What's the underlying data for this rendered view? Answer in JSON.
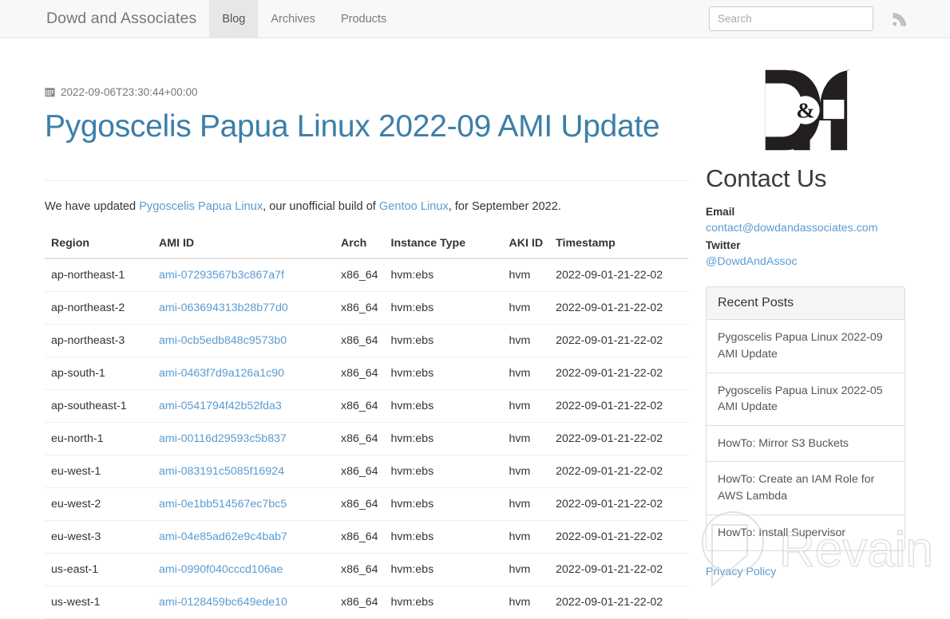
{
  "navbar": {
    "brand": "Dowd and Associates",
    "items": [
      {
        "label": "Blog",
        "active": true
      },
      {
        "label": "Archives",
        "active": false
      },
      {
        "label": "Products",
        "active": false
      }
    ],
    "search": {
      "placeholder": "Search",
      "value": ""
    },
    "rss_icon": "rss-icon"
  },
  "post": {
    "date_icon": "calendar-icon",
    "date": "2022-09-06T23:30:44+00:00",
    "title": "Pygoscelis Papua Linux 2022-09 AMI Update",
    "intro": {
      "part1": "We have updated ",
      "link1": "Pygoscelis Papua Linux",
      "part2": ", our unofficial build of ",
      "link2": "Gentoo Linux",
      "part3": ", for September 2022."
    }
  },
  "table": {
    "headers": [
      "Region",
      "AMI ID",
      "Arch",
      "Instance Type",
      "AKI ID",
      "Timestamp"
    ],
    "rows": [
      {
        "region": "ap-northeast-1",
        "ami_id": "ami-07293567b3c867a7f",
        "arch": "x86_64",
        "instance_type": "hvm:ebs",
        "aki_id": "hvm",
        "timestamp": "2022-09-01-21-22-02"
      },
      {
        "region": "ap-northeast-2",
        "ami_id": "ami-063694313b28b77d0",
        "arch": "x86_64",
        "instance_type": "hvm:ebs",
        "aki_id": "hvm",
        "timestamp": "2022-09-01-21-22-02"
      },
      {
        "region": "ap-northeast-3",
        "ami_id": "ami-0cb5edb848c9573b0",
        "arch": "x86_64",
        "instance_type": "hvm:ebs",
        "aki_id": "hvm",
        "timestamp": "2022-09-01-21-22-02"
      },
      {
        "region": "ap-south-1",
        "ami_id": "ami-0463f7d9a126a1c90",
        "arch": "x86_64",
        "instance_type": "hvm:ebs",
        "aki_id": "hvm",
        "timestamp": "2022-09-01-21-22-02"
      },
      {
        "region": "ap-southeast-1",
        "ami_id": "ami-0541794f42b52fda3",
        "arch": "x86_64",
        "instance_type": "hvm:ebs",
        "aki_id": "hvm",
        "timestamp": "2022-09-01-21-22-02"
      },
      {
        "region": "eu-north-1",
        "ami_id": "ami-00116d29593c5b837",
        "arch": "x86_64",
        "instance_type": "hvm:ebs",
        "aki_id": "hvm",
        "timestamp": "2022-09-01-21-22-02"
      },
      {
        "region": "eu-west-1",
        "ami_id": "ami-083191c5085f16924",
        "arch": "x86_64",
        "instance_type": "hvm:ebs",
        "aki_id": "hvm",
        "timestamp": "2022-09-01-21-22-02"
      },
      {
        "region": "eu-west-2",
        "ami_id": "ami-0e1bb514567ec7bc5",
        "arch": "x86_64",
        "instance_type": "hvm:ebs",
        "aki_id": "hvm",
        "timestamp": "2022-09-01-21-22-02"
      },
      {
        "region": "eu-west-3",
        "ami_id": "ami-04e85ad62e9c4bab7",
        "arch": "x86_64",
        "instance_type": "hvm:ebs",
        "aki_id": "hvm",
        "timestamp": "2022-09-01-21-22-02"
      },
      {
        "region": "us-east-1",
        "ami_id": "ami-0990f040cccd106ae",
        "arch": "x86_64",
        "instance_type": "hvm:ebs",
        "aki_id": "hvm",
        "timestamp": "2022-09-01-21-22-02"
      },
      {
        "region": "us-west-1",
        "ami_id": "ami-0128459bc649ede10",
        "arch": "x86_64",
        "instance_type": "hvm:ebs",
        "aki_id": "hvm",
        "timestamp": "2022-09-01-21-22-02"
      }
    ]
  },
  "sidebar": {
    "logo_alt": "D&A",
    "contact_title": "Contact Us",
    "email_label": "Email",
    "email_value": "contact@dowdandassociates.com",
    "twitter_label": "Twitter",
    "twitter_value": "@DowdAndAssoc",
    "recent_posts_title": "Recent Posts",
    "recent_posts": [
      "Pygoscelis Papua Linux 2022-09 AMI Update",
      "Pygoscelis Papua Linux 2022-05 AMI Update",
      "HowTo: Mirror S3 Buckets",
      "HowTo: Create an IAM Role for AWS Lambda",
      "HowTo: Install Supervisor"
    ],
    "privacy_policy": "Privacy Policy"
  },
  "watermark": {
    "text": "Revain"
  },
  "colors": {
    "link": "#5b9bd0",
    "title": "#3c7fa8",
    "navbar_bg": "#f8f8f8",
    "active_tab_bg": "#e7e7e7",
    "logo": "#231f20"
  }
}
